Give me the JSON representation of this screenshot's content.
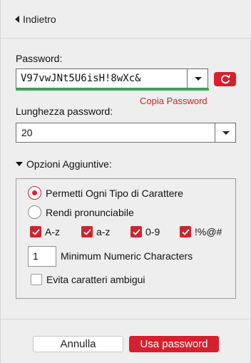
{
  "header": {
    "back_label": "Indietro"
  },
  "password": {
    "label": "Password:",
    "value": "V97vwJNt5U6isH!8wXc&",
    "copy_label": "Copia Password",
    "strength_color": "#2bb34a"
  },
  "length": {
    "label": "Lunghezza password:",
    "value": "20"
  },
  "options": {
    "toggle_label": "Opzioni Aggiuntive:",
    "radios": [
      {
        "label": "Permetti Ogni Tipo di Carattere",
        "selected": true
      },
      {
        "label": "Rendi pronunciabile",
        "selected": false
      }
    ],
    "checkboxes": [
      {
        "label": "A-z",
        "checked": true
      },
      {
        "label": "a-z",
        "checked": true
      },
      {
        "label": "0-9",
        "checked": true
      },
      {
        "label": "!%@#",
        "checked": true
      }
    ],
    "min_numeric": {
      "value": "1",
      "label": "Minimum Numeric Characters"
    },
    "avoid_ambiguous": {
      "label": "Evita caratteri ambigui",
      "checked": false
    }
  },
  "footer": {
    "cancel_label": "Annulla",
    "use_label": "Usa password"
  },
  "colors": {
    "accent": "#d6202e",
    "strength": "#2bb34a"
  }
}
